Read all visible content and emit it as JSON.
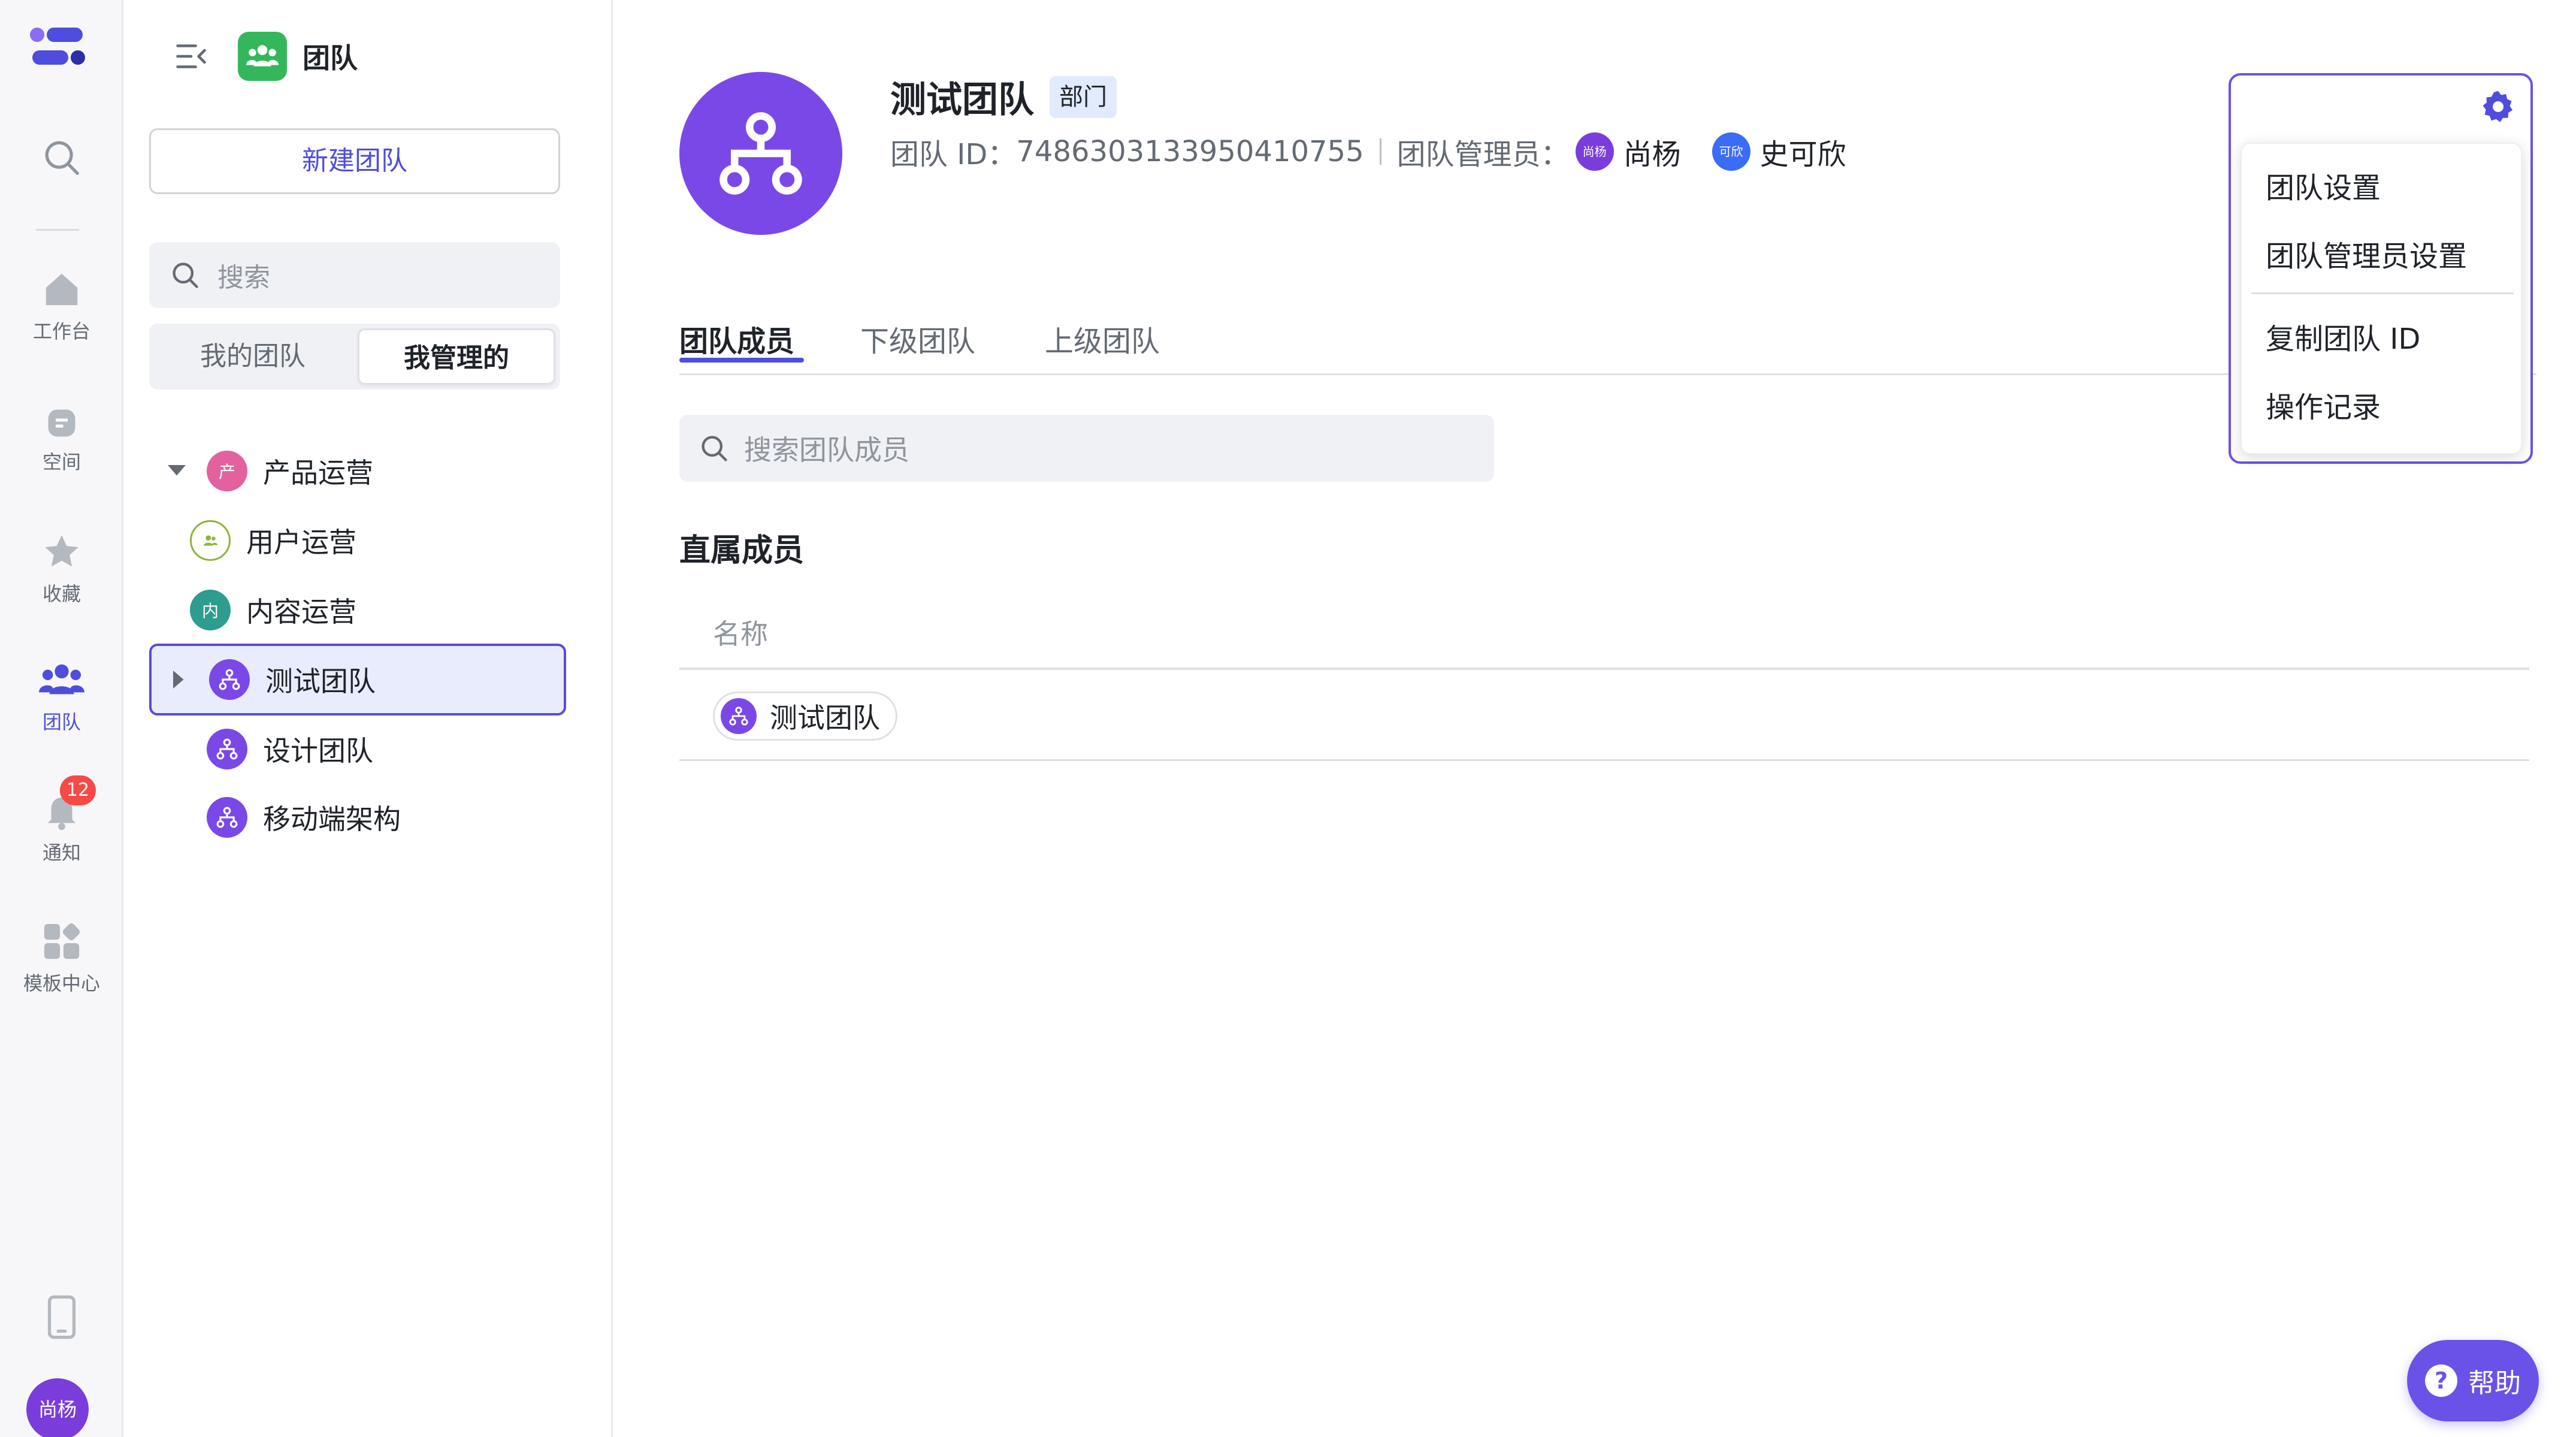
{
  "rail": {
    "items": [
      {
        "label": "工作台",
        "icon": "home-icon"
      },
      {
        "label": "空间",
        "icon": "space-icon"
      },
      {
        "label": "收藏",
        "icon": "star-icon"
      },
      {
        "label": "团队",
        "icon": "team-icon"
      },
      {
        "label": "通知",
        "icon": "bell-icon",
        "badge": "12"
      },
      {
        "label": "模板中心",
        "icon": "template-icon"
      }
    ],
    "avatar": "尚杨",
    "colors": {
      "active": "#4e4dde",
      "inactive": "#646a73"
    }
  },
  "sidebar": {
    "title": "团队",
    "new_team_label": "新建团队",
    "search_placeholder": "搜索",
    "segments": {
      "my_teams": "我的团队",
      "managed": "我管理的"
    },
    "tree": [
      {
        "label": "产品运营",
        "avatar_char": "产",
        "color": "#e3619e"
      },
      {
        "label": "用户运营",
        "color": "#8fb33a"
      },
      {
        "label": "内容运营",
        "avatar_char": "内",
        "color": "#2e9c8e"
      },
      {
        "label": "测试团队",
        "color": "#7b48e8"
      },
      {
        "label": "设计团队",
        "color": "#7b48e8"
      },
      {
        "label": "移动端架构",
        "color": "#7b48e8"
      }
    ]
  },
  "team": {
    "name": "测试团队",
    "tag": "部门",
    "id_label": "团队 ID：",
    "id_value": "7486303133950410755",
    "managers_label": "团队管理员：",
    "managers": [
      {
        "name": "尚杨",
        "short": "尚杨",
        "color": "#7a3ddb"
      },
      {
        "name": "史可欣",
        "short": "可欣",
        "color": "#3b6cf6"
      }
    ]
  },
  "tabs": [
    "团队成员",
    "下级团队",
    "上级团队"
  ],
  "members": {
    "search_placeholder": "搜索团队成员",
    "section_title": "直属成员",
    "column_name": "名称",
    "rows": [
      {
        "name": "测试团队"
      }
    ]
  },
  "menu": {
    "items": [
      "团队设置",
      "团队管理员设置",
      "复制团队 ID",
      "操作记录"
    ]
  },
  "help_label": "帮助"
}
